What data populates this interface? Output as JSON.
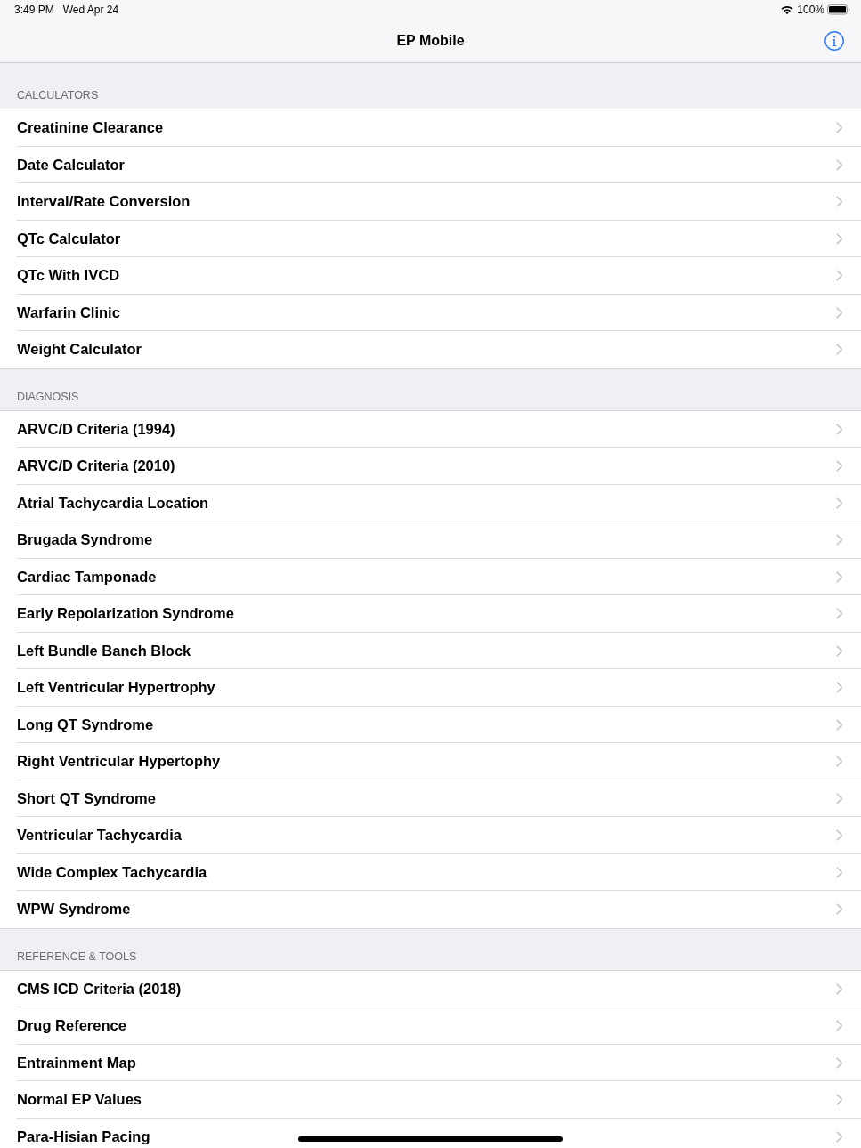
{
  "status_bar": {
    "time": "3:49 PM",
    "date": "Wed Apr 24",
    "battery": "100%"
  },
  "nav_bar": {
    "title": "EP Mobile"
  },
  "sections": [
    {
      "header": "CALCULATORS",
      "items": [
        "Creatinine Clearance",
        "Date Calculator",
        "Interval/Rate Conversion",
        "QTc Calculator",
        "QTc With IVCD",
        "Warfarin Clinic",
        "Weight Calculator"
      ]
    },
    {
      "header": "DIAGNOSIS",
      "items": [
        "ARVC/D Criteria (1994)",
        "ARVC/D Criteria (2010)",
        "Atrial Tachycardia Location",
        "Brugada Syndrome",
        "Cardiac Tamponade",
        "Early Repolarization Syndrome",
        "Left Bundle Banch Block",
        "Left Ventricular Hypertrophy",
        "Long QT Syndrome",
        "Right Ventricular Hypertophy",
        "Short QT Syndrome",
        "Ventricular Tachycardia",
        "Wide Complex Tachycardia",
        "WPW Syndrome"
      ]
    },
    {
      "header": "REFERENCE & TOOLS",
      "items": [
        "CMS ICD Criteria (2018)",
        "Drug Reference",
        "Entrainment Map",
        "Normal EP Values",
        "Para-Hisian Pacing"
      ]
    }
  ]
}
